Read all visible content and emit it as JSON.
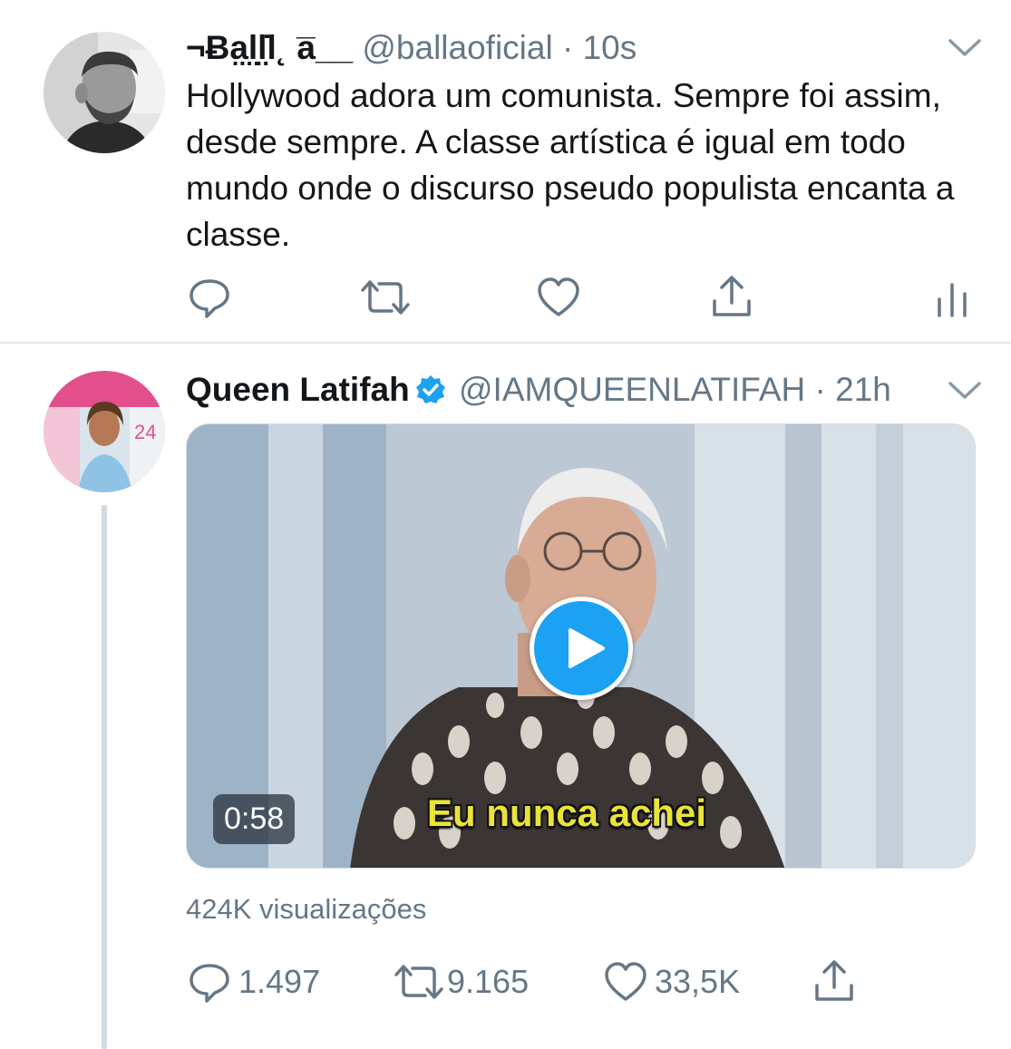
{
  "tweets": [
    {
      "display_name": "¬Ƀa̤l̤l̤̇l˛ a̅__",
      "handle": "@ballaoficial",
      "separator": "·",
      "time": "10s",
      "text": "Hollywood adora um comunista. Sempre foi assim, desde sempre. A classe artística é igual em todo mundo onde o discurso pseudo populista encanta a classe.",
      "actions": {
        "reply_count": "",
        "retweet_count": "",
        "like_count": ""
      }
    },
    {
      "display_name": "Queen Latifah",
      "verified": true,
      "handle": "@IAMQUEENLATIFAH",
      "separator": "·",
      "time": "21h",
      "media": {
        "type": "video",
        "duration": "0:58",
        "subtitle": "Eu nunca achei"
      },
      "views": "424K visualizações",
      "actions": {
        "reply_count": "1.497",
        "retweet_count": "9.165",
        "like_count": "33,5K"
      }
    }
  ],
  "colors": {
    "text_primary": "#14171a",
    "text_secondary": "#657786",
    "accent_blue": "#1da1f2",
    "divider": "#e1e8ed",
    "subtitle_yellow": "#e9e33b"
  },
  "icons": [
    "reply-icon",
    "retweet-icon",
    "like-icon",
    "share-icon",
    "analytics-icon",
    "chevron-down-icon",
    "verified-badge-icon",
    "play-icon"
  ]
}
